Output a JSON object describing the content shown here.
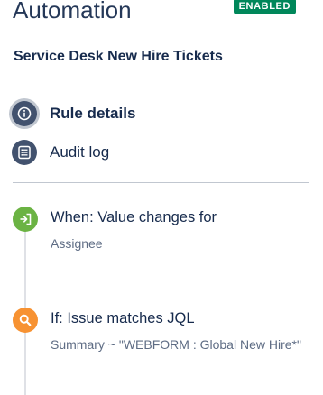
{
  "header": {
    "title": "Automation",
    "status_badge": "ENABLED"
  },
  "rule": {
    "name": "Service Desk New Hire Tickets"
  },
  "nav": {
    "items": [
      {
        "label": "Rule details",
        "icon": "info-icon",
        "active": true
      },
      {
        "label": "Audit log",
        "icon": "list-icon",
        "active": false
      }
    ]
  },
  "steps": [
    {
      "title": "When: Value changes for",
      "description": "Assignee",
      "icon": "trigger-icon",
      "color": "#6bb343"
    },
    {
      "title": "If: Issue matches JQL",
      "description": "Summary ~ \"WEBFORM : Global New Hire*\"",
      "icon": "search-icon",
      "color": "#f79232"
    }
  ],
  "colors": {
    "nav_icon_bg": "#42526e",
    "badge_bg": "#00875a",
    "trigger": "#6bb343",
    "condition": "#f79232"
  }
}
